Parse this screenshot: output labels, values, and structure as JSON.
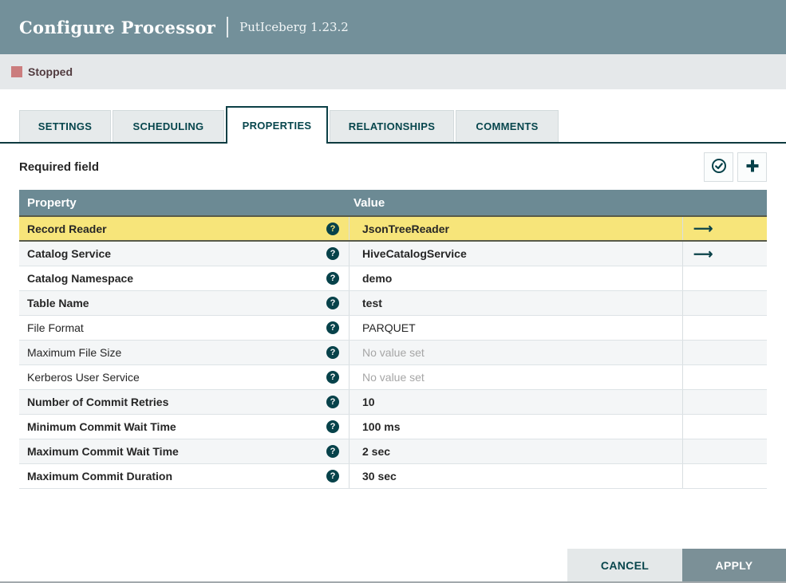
{
  "header": {
    "title": "Configure Processor",
    "subtitle": "PutIceberg 1.23.2"
  },
  "status": {
    "label": "Stopped"
  },
  "tabs": [
    {
      "label": "SETTINGS",
      "active": false
    },
    {
      "label": "SCHEDULING",
      "active": false
    },
    {
      "label": "PROPERTIES",
      "active": true
    },
    {
      "label": "RELATIONSHIPS",
      "active": false
    },
    {
      "label": "COMMENTS",
      "active": false
    }
  ],
  "toolbar": {
    "required_label": "Required field",
    "verify_icon": "check-circle-icon",
    "add_icon": "plus-icon"
  },
  "table": {
    "columns": [
      "Property",
      "Value"
    ],
    "help_glyph": "?",
    "goto_glyph": "⟶",
    "rows": [
      {
        "property": "Record Reader",
        "value": "JsonTreeReader",
        "required": true,
        "selected": true,
        "has_link": true,
        "no_value": false
      },
      {
        "property": "Catalog Service",
        "value": "HiveCatalogService",
        "required": true,
        "selected": false,
        "has_link": true,
        "no_value": false
      },
      {
        "property": "Catalog Namespace",
        "value": "demo",
        "required": true,
        "selected": false,
        "has_link": false,
        "no_value": false
      },
      {
        "property": "Table Name",
        "value": "test",
        "required": true,
        "selected": false,
        "has_link": false,
        "no_value": false
      },
      {
        "property": "File Format",
        "value": "PARQUET",
        "required": false,
        "selected": false,
        "has_link": false,
        "no_value": false
      },
      {
        "property": "Maximum File Size",
        "value": "No value set",
        "required": false,
        "selected": false,
        "has_link": false,
        "no_value": true
      },
      {
        "property": "Kerberos User Service",
        "value": "No value set",
        "required": false,
        "selected": false,
        "has_link": false,
        "no_value": true
      },
      {
        "property": "Number of Commit Retries",
        "value": "10",
        "required": true,
        "selected": false,
        "has_link": false,
        "no_value": false
      },
      {
        "property": "Minimum Commit Wait Time",
        "value": "100 ms",
        "required": true,
        "selected": false,
        "has_link": false,
        "no_value": false
      },
      {
        "property": "Maximum Commit Wait Time",
        "value": "2 sec",
        "required": true,
        "selected": false,
        "has_link": false,
        "no_value": false
      },
      {
        "property": "Maximum Commit Duration",
        "value": "30 sec",
        "required": true,
        "selected": false,
        "has_link": false,
        "no_value": false
      }
    ]
  },
  "footer": {
    "cancel_label": "CANCEL",
    "apply_label": "APPLY"
  },
  "colors": {
    "accent_teal": "#07424a",
    "header_slate": "#73909a",
    "table_header_slate": "#6c8a94",
    "selected_row_yellow": "#f7e57a",
    "stopped_red": "#cb7d7e",
    "status_bar_gray": "#e5e8ea",
    "alt_row_gray": "#f4f6f7",
    "no_value_gray": "#a6a6a6"
  }
}
